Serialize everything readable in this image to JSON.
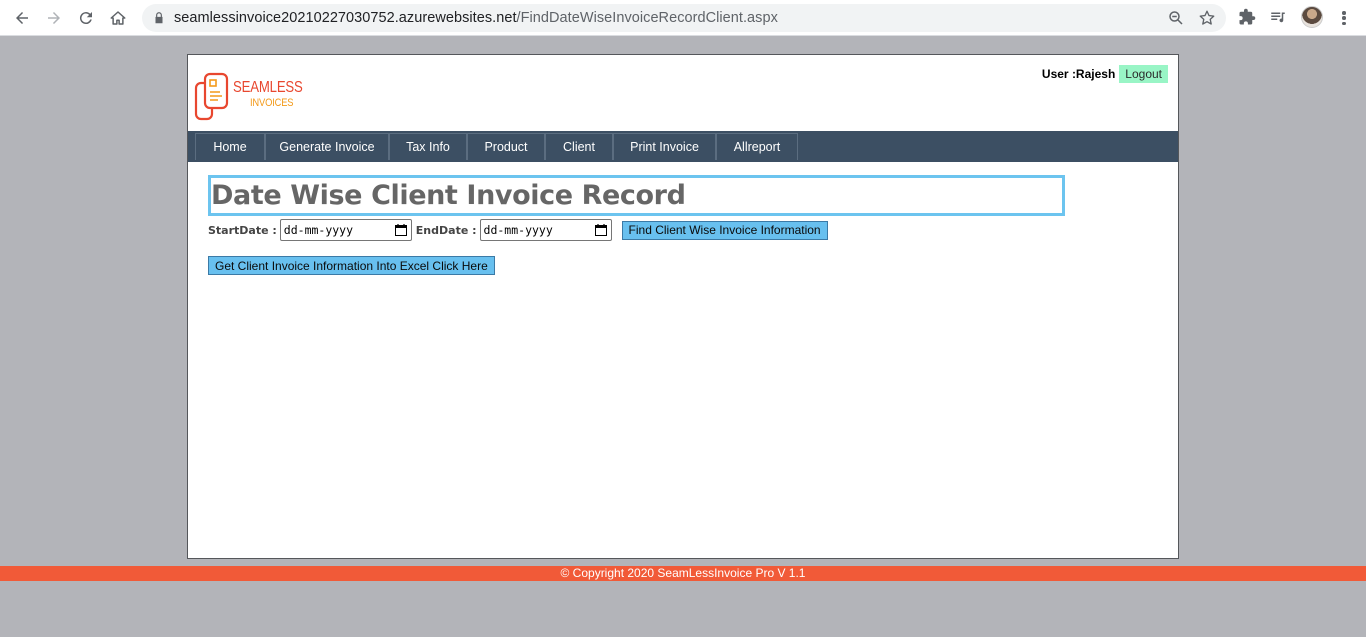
{
  "browser": {
    "url_host": "seamlessinvoice20210227030752.azurewebsites.net",
    "url_path": "/FindDateWiseInvoiceRecordClient.aspx"
  },
  "header": {
    "logo_line1": "SEAMLESS",
    "logo_line2": "INVOICES",
    "user_label": "User :Rajesh",
    "logout_label": "Logout"
  },
  "menu": {
    "items": [
      {
        "label": "Home"
      },
      {
        "label": "Generate Invoice"
      },
      {
        "label": "Tax Info"
      },
      {
        "label": "Product"
      },
      {
        "label": "Client"
      },
      {
        "label": "Print Invoice"
      },
      {
        "label": "Allreport"
      }
    ]
  },
  "main": {
    "title": "Date Wise Client Invoice Record",
    "start_label": "StartDate :",
    "start_placeholder": "dd-mm-yyyy",
    "end_label": "EndDate :",
    "end_placeholder": "dd-mm-yyyy",
    "find_button": "Find Client Wise Invoice Information",
    "excel_button": "Get Client Invoice Information Into Excel Click Here"
  },
  "footer": {
    "text": "© Copyright 2020 SeamLessInvoice Pro V 1.1"
  },
  "colors": {
    "menu_bg": "#3c4f63",
    "accent_blue": "#68c0ef",
    "logout_green": "#99f5c6",
    "footer_orange": "#f15a38",
    "page_bg": "#b3b4b9"
  }
}
